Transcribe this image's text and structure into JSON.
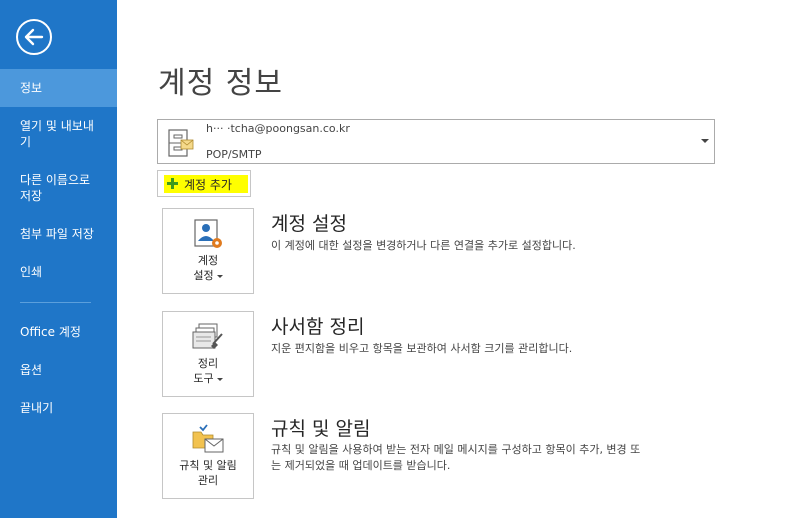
{
  "sidebar": {
    "back_icon": "back-arrow-icon",
    "items": [
      {
        "label": "정보"
      },
      {
        "label": "열기 및 내보내\n기"
      },
      {
        "label": "다른 이름으로\n저장"
      },
      {
        "label": "첨부 파일 저장"
      },
      {
        "label": "인쇄"
      },
      {
        "label": "Office 계정"
      },
      {
        "label": "옵션"
      },
      {
        "label": "끝내기"
      }
    ]
  },
  "main": {
    "title": "계정 정보",
    "account": {
      "email": "h··· ·tcha@poongsan.co.kr",
      "type": "POP/SMTP"
    },
    "add_account_label": "계정 추가",
    "sections": [
      {
        "tile_label_line1": "계정",
        "tile_label_line2": "설정",
        "title": "계정 설정",
        "description": "이 계정에 대한 설정을 변경하거나 다른 연결을 추가로 설정합니다."
      },
      {
        "tile_label_line1": "정리",
        "tile_label_line2": "도구",
        "title": "사서함 정리",
        "description": "지운 편지함을 비우고 항목을 보관하여 사서함 크기를 관리합니다."
      },
      {
        "tile_label_line1": "규칙 및 알림",
        "tile_label_line2": "관리",
        "title": "규칙 및 알림",
        "description": "규칙 및 알림을 사용하여 받는 전자 메일 메시지를 구성하고 항목이 추가, 변경 또\n는 제거되었을 때 업데이트를 받습니다."
      }
    ]
  },
  "colors": {
    "sidebar_bg": "#1f76c8",
    "sidebar_active": "#4c98dc",
    "highlight": "#ffff00"
  }
}
